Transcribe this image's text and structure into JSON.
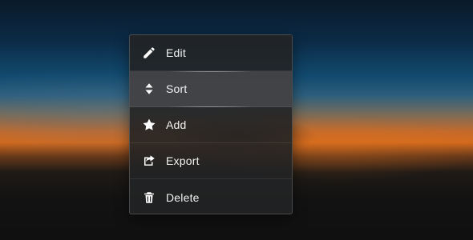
{
  "menu": {
    "items": [
      {
        "label": "Edit",
        "icon": "pencil-icon"
      },
      {
        "label": "Sort",
        "icon": "sort-icon"
      },
      {
        "label": "Add",
        "icon": "star-icon"
      },
      {
        "label": "Export",
        "icon": "share-icon"
      },
      {
        "label": "Delete",
        "icon": "trash-icon"
      }
    ],
    "hovered_index": 1
  },
  "colors": {
    "menu_background": "#222325",
    "hover_background": "#46484b",
    "text": "#f2f2f2",
    "sky_top": "#0a1a2a",
    "horizon_orange": "#d46a1d"
  }
}
